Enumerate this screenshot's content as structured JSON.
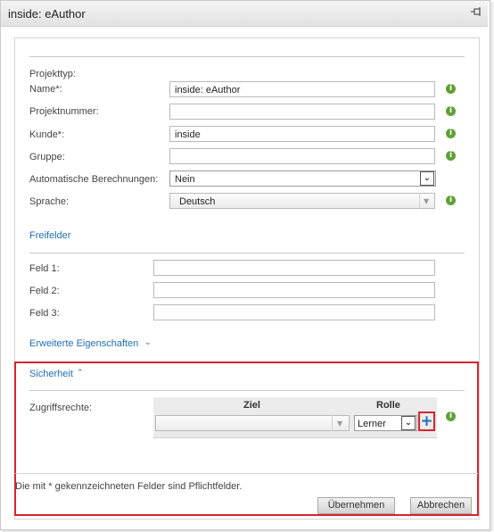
{
  "window": {
    "title": "inside: eAuthor"
  },
  "form": {
    "project_type_label": "Projekttyp:",
    "name_label": "Name*:",
    "name_value": "inside: eAuthor",
    "project_number_label": "Projektnummer:",
    "project_number_value": "",
    "customer_label": "Kunde*:",
    "customer_value": "inside",
    "group_label": "Gruppe:",
    "group_value": "",
    "auto_calc_label": "Automatische Berechnungen:",
    "auto_calc_value": "Nein",
    "language_label": "Sprache:",
    "language_value": "Deutsch"
  },
  "freifelder": {
    "link": "Freifelder",
    "field1_label": "Feld 1:",
    "field2_label": "Feld 2:",
    "field3_label": "Feld 3:"
  },
  "extended": {
    "link": "Erweiterte Eigenschaften"
  },
  "security": {
    "link": "Sicherheit",
    "access_label": "Zugriffsrechte:",
    "col_target": "Ziel",
    "col_role": "Rolle",
    "target_value": "",
    "role_value": "Lerner"
  },
  "footer": {
    "required_note": "Die mit * gekennzeichneten Felder sind Pflichtfelder.",
    "apply_label": "Übernehmen",
    "cancel_label": "Abbrechen"
  },
  "icons": {
    "info": "i",
    "pin": "pin-icon",
    "chevron_down": "⌄",
    "chevron_up": "^",
    "plus": "+"
  },
  "colors": {
    "accent_link": "#1f6fb5",
    "info_green": "#5fa136",
    "highlight_red": "#d9232e"
  }
}
